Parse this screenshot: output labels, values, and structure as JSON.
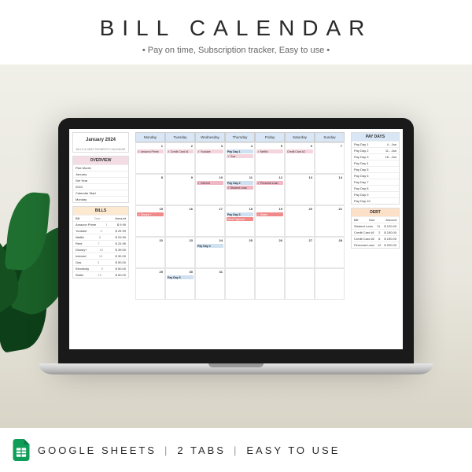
{
  "header": {
    "title": "BILL CALENDAR",
    "subtitle": "• Pay on time, Subscription tracker, Easy to use •"
  },
  "footer": {
    "platform": "GOOGLE SHEETS",
    "tabs": "2 TABS",
    "ease": "EASY TO USE"
  },
  "spreadsheet": {
    "month_title": "January 2024",
    "caption": "BILLS & DEBT PAYMENTS CALENDAR",
    "overview": {
      "header": "OVERVIEW",
      "rows": [
        [
          "Pick Month",
          ""
        ],
        [
          "January",
          ""
        ],
        [
          "Set Year",
          ""
        ],
        [
          "2024",
          ""
        ],
        [
          "Calendar Start",
          ""
        ],
        [
          "Monday",
          ""
        ]
      ]
    },
    "bills": {
      "header": "BILLS",
      "cols": [
        "Bill",
        "Due",
        "Amount"
      ],
      "rows": [
        [
          "Amazon Prime",
          "1",
          "$ 9.99"
        ],
        [
          "Youtube",
          "3",
          "$ 29.99"
        ],
        [
          "Netflix",
          "5",
          "$ 29.99"
        ],
        [
          "Rent",
          "7",
          "$ 24.99"
        ],
        [
          "Disney+",
          "15",
          "$ 39.00"
        ],
        [
          "Internet",
          "10",
          "$ 30.00"
        ],
        [
          "Gas",
          "3",
          "$ 50.00"
        ],
        [
          "Electricity",
          "9",
          "$ 50.00"
        ],
        [
          "Water",
          "19",
          "$ 60.00"
        ]
      ]
    },
    "paydays": {
      "header": "PAY DAYS",
      "rows": [
        [
          "Pay Day 1",
          "4 - Jan"
        ],
        [
          "Pay Day 2",
          "11 - Jan"
        ],
        [
          "Pay Day 3",
          "18 - Jan"
        ],
        [
          "Pay Day 4",
          ""
        ],
        [
          "Pay Day 5",
          ""
        ],
        [
          "Pay Day 6",
          ""
        ],
        [
          "Pay Day 7",
          ""
        ],
        [
          "Pay Day 8",
          ""
        ],
        [
          "Pay Day 9",
          ""
        ],
        [
          "Pay Day 10",
          ""
        ]
      ]
    },
    "debt": {
      "header": "DEBT",
      "cols": [
        "Bill",
        "Due",
        "Amount"
      ],
      "rows": [
        [
          "Student Loan",
          "11",
          "$ 120.00"
        ],
        [
          "Credit Card #1",
          "2",
          "$ 150.00"
        ],
        [
          "Credit Card #2",
          "6",
          "$ 190.00"
        ],
        [
          "Personal Loan",
          "12",
          "$ 200.00"
        ]
      ]
    },
    "calendar": {
      "days": [
        "Monday",
        "Tuesday",
        "Wednesday",
        "Thursday",
        "Friday",
        "Saturday",
        "Sunday"
      ],
      "weeks": [
        [
          {
            "d": "1",
            "items": [
              {
                "t": "✓ Amazon Prime",
                "c": "pink"
              }
            ]
          },
          {
            "d": "2",
            "items": [
              {
                "t": "✓ Credit Card #1",
                "c": "pink"
              }
            ]
          },
          {
            "d": "3",
            "items": [
              {
                "t": "✓ Youtube",
                "c": "pink"
              }
            ]
          },
          {
            "d": "4",
            "items": [
              {
                "t": "Pay Day 1",
                "c": "payday"
              },
              {
                "t": "✓ Gas",
                "c": "pink"
              }
            ]
          },
          {
            "d": "5",
            "items": [
              {
                "t": "✓ Netflix",
                "c": "pink"
              }
            ]
          },
          {
            "d": "6",
            "items": [
              {
                "t": "Credit Card #2",
                "c": "pink"
              }
            ]
          },
          {
            "d": "7",
            "items": []
          }
        ],
        [
          {
            "d": "8",
            "items": []
          },
          {
            "d": "9",
            "items": []
          },
          {
            "d": "10",
            "items": [
              {
                "t": "✓ Internet",
                "c": "pink2"
              }
            ]
          },
          {
            "d": "11",
            "items": [
              {
                "t": "Pay Day 2",
                "c": "payday"
              },
              {
                "t": "✓ Student Loan",
                "c": "pink2"
              }
            ]
          },
          {
            "d": "12",
            "items": [
              {
                "t": "✓ Personal Loan",
                "c": "pink2"
              }
            ]
          },
          {
            "d": "13",
            "items": []
          },
          {
            "d": "14",
            "items": []
          }
        ],
        [
          {
            "d": "15",
            "items": [
              {
                "t": "✓ Disney +",
                "c": "red"
              }
            ]
          },
          {
            "d": "16",
            "items": []
          },
          {
            "d": "17",
            "items": []
          },
          {
            "d": "18",
            "items": [
              {
                "t": "Pay Day 3",
                "c": "payday"
              },
              {
                "t": "Rent Payment",
                "c": "red"
              }
            ]
          },
          {
            "d": "19",
            "items": [
              {
                "t": "✓ Water",
                "c": "red"
              }
            ]
          },
          {
            "d": "20",
            "items": []
          },
          {
            "d": "21",
            "items": []
          }
        ],
        [
          {
            "d": "22",
            "items": []
          },
          {
            "d": "23",
            "items": []
          },
          {
            "d": "24",
            "items": [
              {
                "t": "Pay Day 4",
                "c": "payday"
              }
            ]
          },
          {
            "d": "25",
            "items": []
          },
          {
            "d": "26",
            "items": []
          },
          {
            "d": "27",
            "items": []
          },
          {
            "d": "28",
            "items": []
          }
        ],
        [
          {
            "d": "29",
            "items": []
          },
          {
            "d": "30",
            "items": [
              {
                "t": "Pay Day 5",
                "c": "payday"
              }
            ]
          },
          {
            "d": "31",
            "items": []
          },
          {
            "d": "",
            "items": []
          },
          {
            "d": "",
            "items": []
          },
          {
            "d": "",
            "items": []
          },
          {
            "d": "",
            "items": []
          }
        ]
      ]
    }
  }
}
